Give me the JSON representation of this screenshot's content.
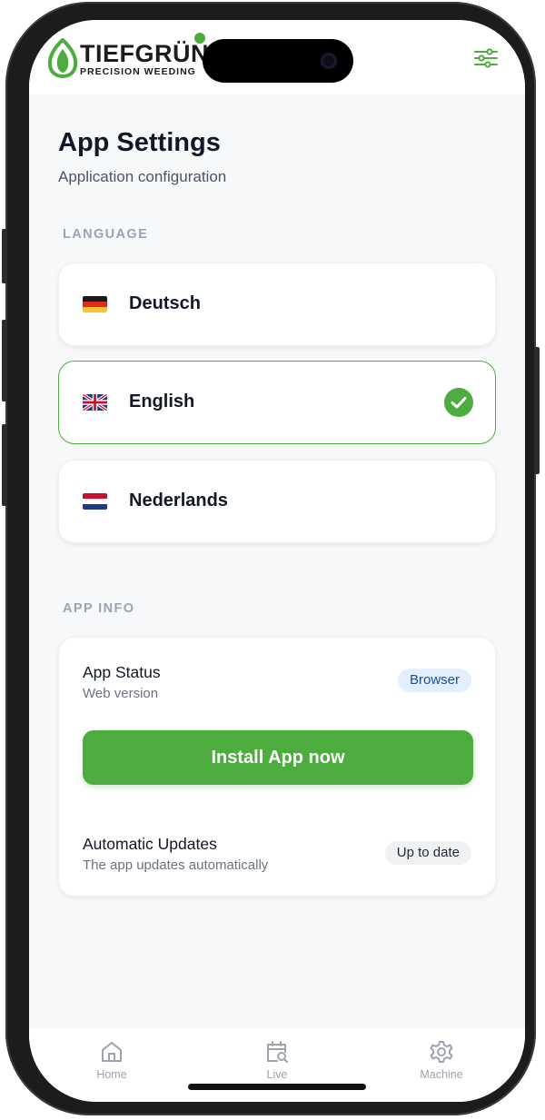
{
  "brand": {
    "name": "TIEFGRÜN",
    "tagline": "PRECISION WEEDING",
    "color": "#4cad3e"
  },
  "header": {
    "menu_icon": "sliders-icon"
  },
  "page": {
    "title": "App Settings",
    "subtitle": "Application configuration"
  },
  "language": {
    "section_label": "LANGUAGE",
    "options": [
      {
        "label": "Deutsch",
        "flag": "flag-germany-icon",
        "selected": false
      },
      {
        "label": "English",
        "flag": "flag-uk-icon",
        "selected": true
      },
      {
        "label": "Nederlands",
        "flag": "flag-netherlands-icon",
        "selected": false
      }
    ]
  },
  "app_info": {
    "section_label": "APP INFO",
    "status": {
      "title": "App Status",
      "subtitle": "Web version",
      "badge": "Browser"
    },
    "install_button": "Install App now",
    "updates": {
      "title": "Automatic Updates",
      "subtitle": "The app updates automatically",
      "badge": "Up to date"
    }
  },
  "bottom_nav": {
    "items": [
      {
        "label": "Home",
        "icon": "home-icon"
      },
      {
        "label": "Live",
        "icon": "calendar-search-icon"
      },
      {
        "label": "Machine",
        "icon": "gear-icon"
      }
    ]
  },
  "colors": {
    "accent": "#4cad3e",
    "browser_badge_bg": "#e3efff",
    "browser_badge_text": "#1d4f99"
  }
}
